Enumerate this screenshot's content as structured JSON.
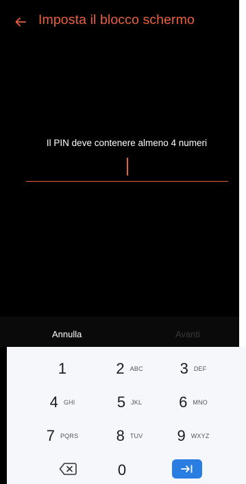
{
  "header": {
    "title": "Imposta il blocco schermo",
    "back_icon": "arrow-left-icon",
    "accent_color": "#e9603e"
  },
  "main": {
    "hint": "Il PIN deve contenere almeno 4 numeri"
  },
  "actions": {
    "cancel_label": "Annulla",
    "next_label": "Avanti"
  },
  "keyboard": {
    "rows": [
      [
        {
          "num": "1",
          "letters": ""
        },
        {
          "num": "2",
          "letters": "ABC"
        },
        {
          "num": "3",
          "letters": "DEF"
        }
      ],
      [
        {
          "num": "4",
          "letters": "GHI"
        },
        {
          "num": "5",
          "letters": "JKL"
        },
        {
          "num": "6",
          "letters": "MNO"
        }
      ],
      [
        {
          "num": "7",
          "letters": "PQRS"
        },
        {
          "num": "8",
          "letters": "TUV"
        },
        {
          "num": "9",
          "letters": "WXYZ"
        }
      ]
    ],
    "zero": "0",
    "backspace_icon": "backspace-icon",
    "enter_icon": "enter-icon",
    "enter_color": "#2a7de1"
  }
}
